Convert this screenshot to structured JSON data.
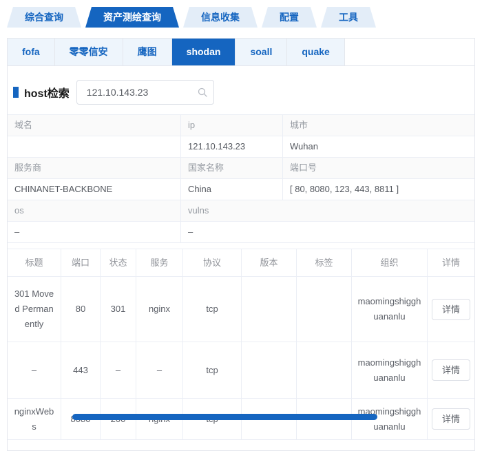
{
  "colors": {
    "primary": "#1565c0",
    "tab_inactive_bg": "#e3edf8",
    "cell_border": "#ebeef5",
    "label_text": "#979ca3",
    "value_text": "#54585f"
  },
  "top_tabs": [
    {
      "label": "综合查询",
      "active": false
    },
    {
      "label": "资产测绘查询",
      "active": true
    },
    {
      "label": "信息收集",
      "active": false
    },
    {
      "label": "配置",
      "active": false
    },
    {
      "label": "工具",
      "active": false
    }
  ],
  "sub_tabs": [
    {
      "label": "fofa",
      "active": false
    },
    {
      "label": "零零信安",
      "active": false
    },
    {
      "label": "鹰图",
      "active": false
    },
    {
      "label": "shodan",
      "active": true
    },
    {
      "label": "soall",
      "active": false
    },
    {
      "label": "quake",
      "active": false
    }
  ],
  "search": {
    "section_title": "host检索",
    "value": "121.10.143.23",
    "icon": "search-icon"
  },
  "host_info": {
    "rows": [
      {
        "labels": [
          "域名",
          "ip",
          "城市"
        ],
        "values": [
          "",
          "121.10.143.23",
          "Wuhan"
        ]
      },
      {
        "labels": [
          "服务商",
          "国家名称",
          "端口号"
        ],
        "values": [
          "CHINANET-BACKBONE",
          "China",
          "[ 80, 8080, 123, 443, 8811 ]"
        ]
      },
      {
        "labels": [
          "os",
          "vulns"
        ],
        "values": [
          "–",
          "–"
        ]
      }
    ]
  },
  "ports_table": {
    "headers": [
      "标题",
      "端口",
      "状态",
      "服务",
      "协议",
      "版本",
      "标签",
      "组织",
      "详情"
    ],
    "detail_button": "详情",
    "rows": [
      {
        "title": "301 Moved Permanently",
        "port": "80",
        "status": "301",
        "service": "nginx",
        "protocol": "tcp",
        "version": "",
        "tags": "",
        "org": "maomingshigghuananlu"
      },
      {
        "title": "–",
        "port": "443",
        "status": "–",
        "service": "–",
        "protocol": "tcp",
        "version": "",
        "tags": "",
        "org": "maomingshigghuananlu"
      },
      {
        "title": "nginxWebs",
        "port": "8080",
        "status": "200",
        "service": "nginx",
        "protocol": "tcp",
        "version": "",
        "tags": "",
        "org": "maomingshigghuananlu"
      }
    ]
  }
}
